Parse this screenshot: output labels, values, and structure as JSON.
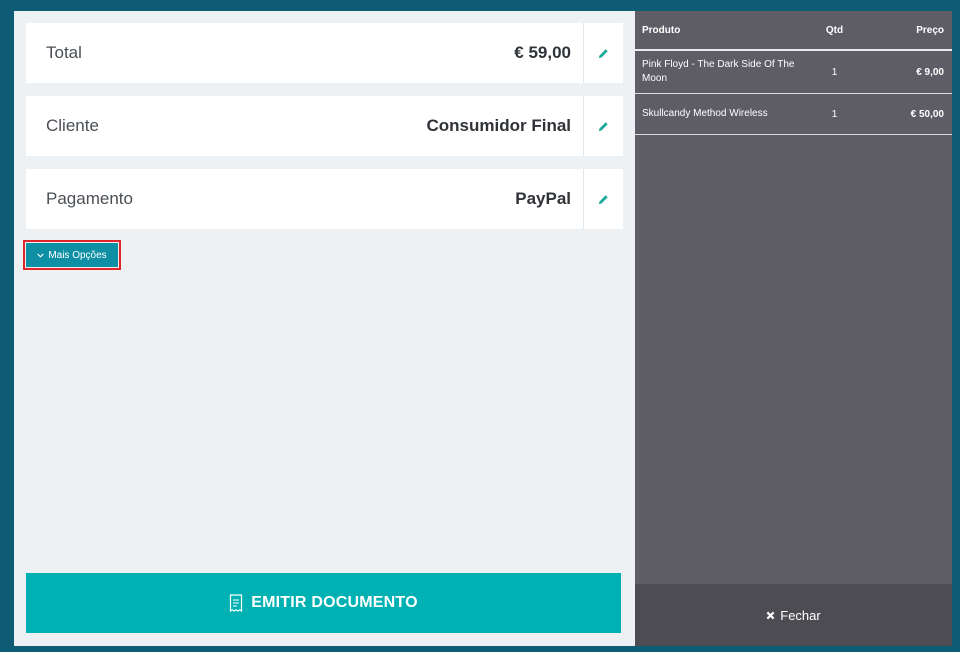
{
  "summary": {
    "rows": [
      {
        "label": "Total",
        "value": "€ 59,00"
      },
      {
        "label": "Cliente",
        "value": "Consumidor Final"
      },
      {
        "label": "Pagamento",
        "value": "PayPal"
      }
    ]
  },
  "more_options_label": "Mais Opções",
  "emit_button_label": "EMITIR DOCUMENTO",
  "products_table": {
    "headers": {
      "product": "Produto",
      "qty": "Qtd",
      "price": "Preço"
    },
    "rows": [
      {
        "product": "Pink Floyd - The Dark Side Of The Moon",
        "qty": "1",
        "price": "€ 9,00"
      },
      {
        "product": "Skullcandy Method Wireless",
        "qty": "1",
        "price": "€ 50,00"
      }
    ]
  },
  "close_label": "Fechar",
  "icons": {
    "edit": "pencil-icon",
    "more": "chevron-down-icon",
    "document": "receipt-icon",
    "close": "close-icon"
  },
  "colors": {
    "accent": "#00b1b3",
    "edit_icon": "#1aa99a",
    "more_button": "#0f8fa3",
    "panel_dark": "#5e5d66",
    "background": "#0e5b76"
  }
}
